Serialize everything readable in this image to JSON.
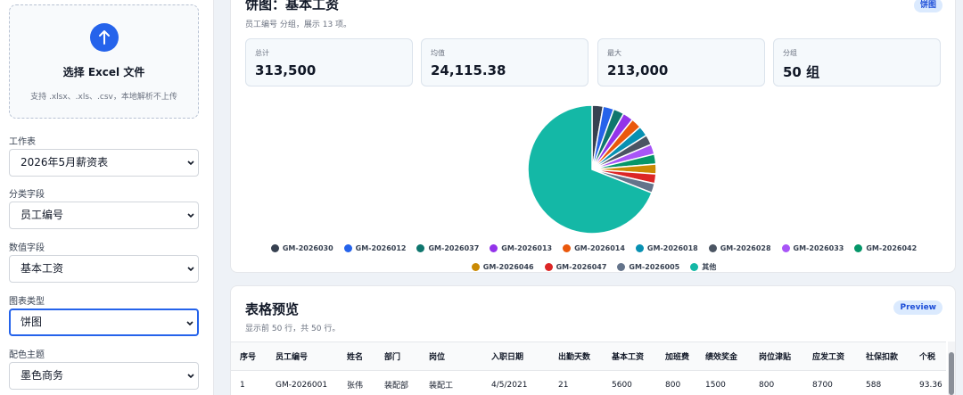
{
  "sidebar": {
    "upload": {
      "title": "选择 Excel 文件",
      "subtitle": "支持 .xlsx、.xls、.csv，本地解析不上传",
      "icon": "upload-arrow-icon"
    },
    "fields": [
      {
        "label": "工作表",
        "value": "2026年5月薪资表"
      },
      {
        "label": "分类字段",
        "value": "员工编号"
      },
      {
        "label": "数值字段",
        "value": "基本工资"
      },
      {
        "label": "图表类型",
        "value": "饼图"
      },
      {
        "label": "配色主题",
        "value": "墨色商务"
      }
    ]
  },
  "chart_card": {
    "title": "饼图：基本工资",
    "subtitle": "员工编号 分组，展示 13 项。",
    "badge": "饼图",
    "stats": [
      {
        "label": "总计",
        "value": "313,500"
      },
      {
        "label": "均值",
        "value": "24,115.38"
      },
      {
        "label": "最大",
        "value": "213,000"
      },
      {
        "label": "分组",
        "value": "50 组"
      }
    ]
  },
  "chart_data": {
    "type": "pie",
    "categories": [
      "GM-2026030",
      "GM-2026012",
      "GM-2026037",
      "GM-2026013",
      "GM-2026014",
      "GM-2026018",
      "GM-2026028",
      "GM-2026033",
      "GM-2026042",
      "GM-2026046",
      "GM-2026047",
      "GM-2026005",
      "其他"
    ],
    "values": [
      8600,
      8400,
      8300,
      8200,
      8100,
      8000,
      7900,
      7800,
      7700,
      7600,
      7500,
      7400,
      213000
    ],
    "colors": [
      "#374151",
      "#2563eb",
      "#0f766e",
      "#9333ea",
      "#ea580c",
      "#0891b2",
      "#4b5563",
      "#a855f7",
      "#059669",
      "#ca8a04",
      "#dc2626",
      "#64748b",
      "#14b8a6"
    ]
  },
  "table_card": {
    "title": "表格预览",
    "subtitle": "显示前 50 行，共 50 行。",
    "badge": "Preview",
    "columns": [
      "序号",
      "员工编号",
      "姓名",
      "部门",
      "岗位",
      "入职日期",
      "出勤天数",
      "基本工资",
      "加班费",
      "绩效奖金",
      "岗位津贴",
      "应发工资",
      "社保扣款",
      "个税"
    ],
    "rows": [
      [
        "1",
        "GM-2026001",
        "张伟",
        "装配部",
        "装配工",
        "4/5/2021",
        "21",
        "5600",
        "800",
        "1500",
        "800",
        "8700",
        "588",
        "93.36"
      ]
    ]
  }
}
